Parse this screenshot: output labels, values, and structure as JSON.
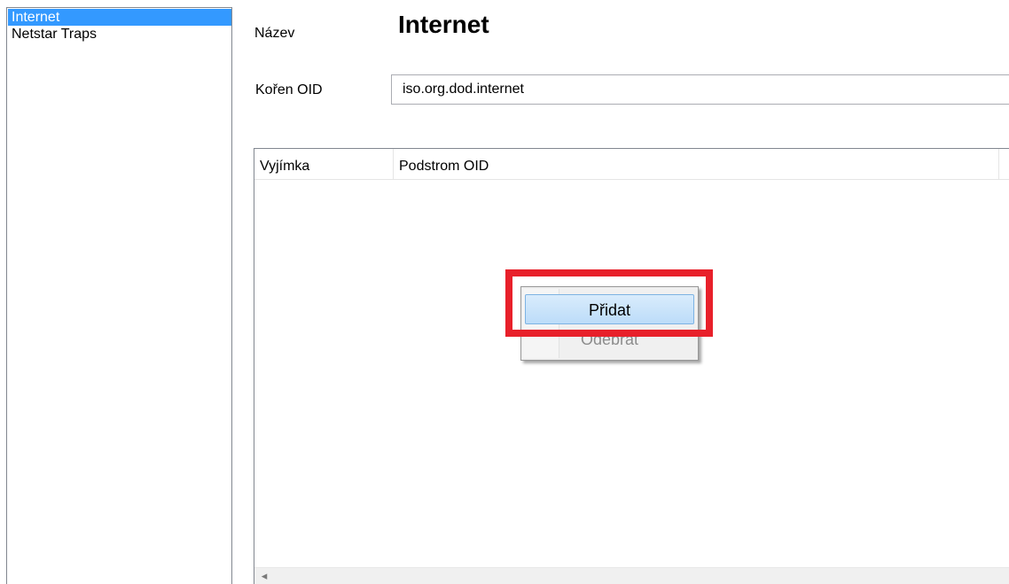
{
  "left_list": {
    "items": [
      {
        "label": "Internet",
        "selected": true
      },
      {
        "label": "Netstar Traps",
        "selected": false
      }
    ]
  },
  "form": {
    "name_label": "Název",
    "name_value": "Internet",
    "oid_root_label": "Kořen OID",
    "oid_root_value": "iso.org.dod.internet"
  },
  "table": {
    "columns": [
      "Vyjímka",
      "Podstrom OID"
    ],
    "scroll_left_icon": "◂"
  },
  "context_menu": {
    "items": [
      {
        "label": "Přidat",
        "state": "hover"
      },
      {
        "label": "Odebrat",
        "state": "disabled"
      }
    ]
  },
  "colors": {
    "selection": "#3399ff",
    "highlight_border": "#e8202a",
    "menu_hover": "#cce4f7"
  }
}
